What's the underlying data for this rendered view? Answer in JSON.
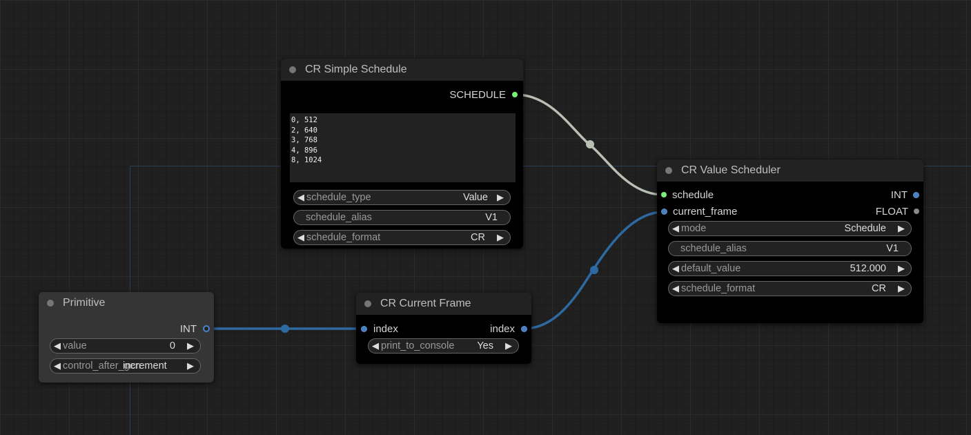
{
  "nodes": {
    "simple_schedule": {
      "title": "CR Simple Schedule",
      "output_label": "SCHEDULE",
      "schedule_text": "0, 512\n2, 640\n3, 768\n4, 896\n8, 1024",
      "widgets": {
        "schedule_type": {
          "label": "schedule_type",
          "value": "Value"
        },
        "schedule_alias": {
          "label": "schedule_alias",
          "value": "V1"
        },
        "schedule_format": {
          "label": "schedule_format",
          "value": "CR"
        }
      }
    },
    "value_scheduler": {
      "title": "CR Value Scheduler",
      "inputs": [
        "schedule",
        "current_frame"
      ],
      "outputs": [
        "INT",
        "FLOAT"
      ],
      "widgets": {
        "mode": {
          "label": "mode",
          "value": "Schedule"
        },
        "schedule_alias": {
          "label": "schedule_alias",
          "value": "V1"
        },
        "default_value": {
          "label": "default_value",
          "value": "512.000"
        },
        "schedule_format": {
          "label": "schedule_format",
          "value": "CR"
        }
      }
    },
    "primitive": {
      "title": "Primitive",
      "output_label": "INT",
      "widgets": {
        "value": {
          "label": "value",
          "value": "0"
        },
        "control_after_generate": {
          "label": "control_after_generate",
          "value": "increment"
        }
      }
    },
    "current_frame": {
      "title": "CR Current Frame",
      "input_label": "index",
      "output_label": "index",
      "widgets": {
        "print_to_console": {
          "label": "print_to_console",
          "value": "Yes"
        }
      }
    }
  },
  "colors": {
    "schedule_link": "#b9bfb3",
    "int_link": "#2e6aa2",
    "schedule_dot": "#7af07a",
    "int_dot": "#4a7fc0"
  },
  "icons": {
    "widget_left": "triangle-left-icon",
    "widget_right": "triangle-right-icon"
  }
}
